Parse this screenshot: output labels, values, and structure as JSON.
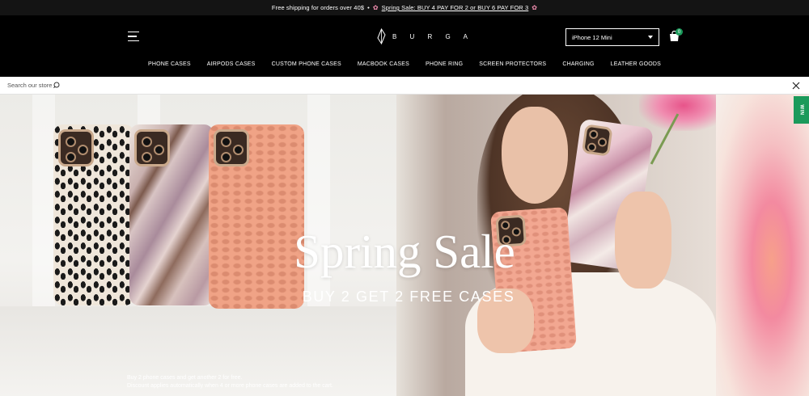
{
  "announcement": {
    "shipping": "Free shipping for orders over 40$",
    "separator": "•",
    "flower_icon": "cherry-blossom-icon",
    "sale_link": "Spring Sale: BUY 4 PAY FOR 2 or BUY 6 PAY FOR 3"
  },
  "header": {
    "logo_text": "B U R G A",
    "device_select": {
      "value": "iPhone 12 Mini"
    },
    "cart_count": "0",
    "nav": [
      "PHONE CASES",
      "AIRPODS CASES",
      "CUSTOM PHONE CASES",
      "MACBOOK CASES",
      "PHONE RING",
      "SCREEN PROTECTORS",
      "CHARGING",
      "LEATHER GOODS"
    ]
  },
  "search": {
    "placeholder": "Search our store"
  },
  "hero": {
    "title": "Spring Sale",
    "subtitle": "BUY 2 GET 2 FREE CASES",
    "note_line1": "Buy 2 phone cases and get another 2 for free.",
    "note_line2": "Discount applies automatically when 4 or more phone cases are added to the cart."
  },
  "side_tab": {
    "label": "WIN"
  },
  "colors": {
    "header_bg": "#000000",
    "accent_green": "#1b9a5b",
    "pink": "#f48fb1"
  }
}
